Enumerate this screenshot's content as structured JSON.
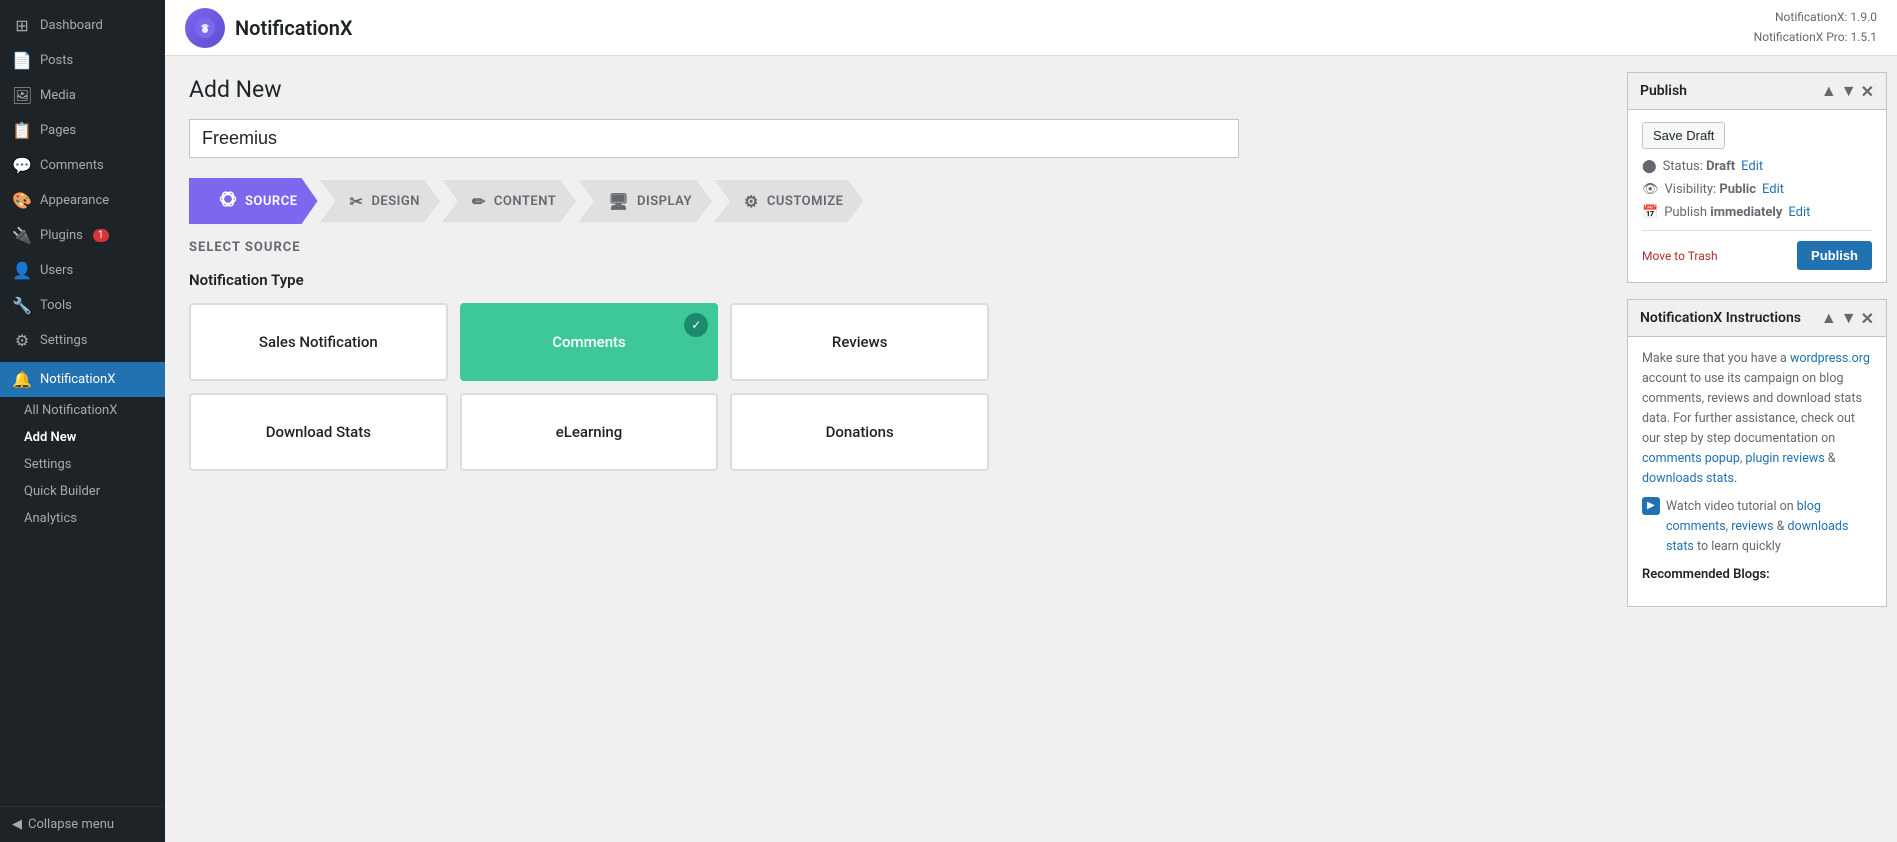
{
  "sidebar": {
    "items": [
      {
        "id": "dashboard",
        "label": "Dashboard",
        "icon": "⊞"
      },
      {
        "id": "posts",
        "label": "Posts",
        "icon": "📄"
      },
      {
        "id": "media",
        "label": "Media",
        "icon": "🖼"
      },
      {
        "id": "pages",
        "label": "Pages",
        "icon": "📋"
      },
      {
        "id": "comments",
        "label": "Comments",
        "icon": "💬"
      },
      {
        "id": "appearance",
        "label": "Appearance",
        "icon": "🎨"
      },
      {
        "id": "plugins",
        "label": "Plugins",
        "icon": "🔌",
        "badge": "1"
      },
      {
        "id": "users",
        "label": "Users",
        "icon": "👤"
      },
      {
        "id": "tools",
        "label": "Tools",
        "icon": "🔧"
      },
      {
        "id": "settings",
        "label": "Settings",
        "icon": "⚙"
      }
    ],
    "notificationx": {
      "label": "NotificationX",
      "subitems": [
        {
          "id": "all",
          "label": "All NotificationX"
        },
        {
          "id": "add-new",
          "label": "Add New",
          "active": true
        },
        {
          "id": "settings",
          "label": "Settings"
        },
        {
          "id": "quick-builder",
          "label": "Quick Builder"
        },
        {
          "id": "analytics",
          "label": "Analytics"
        }
      ]
    },
    "collapse_label": "Collapse menu"
  },
  "topbar": {
    "brand_name": "NotificationX",
    "version_line1": "NotificationX: 1.9.0",
    "version_line2": "NotificationX Pro: 1.5.1"
  },
  "page": {
    "title": "Add New",
    "title_input_value": "Freemius",
    "title_input_placeholder": "Freemius"
  },
  "steps": [
    {
      "id": "source",
      "label": "SOURCE",
      "icon": "⬡",
      "active": true
    },
    {
      "id": "design",
      "label": "DESIGN",
      "icon": "✂"
    },
    {
      "id": "content",
      "label": "CONTENT",
      "icon": "✏"
    },
    {
      "id": "display",
      "label": "DISPLAY",
      "icon": "🖥"
    },
    {
      "id": "customize",
      "label": "CUSTOMIZE",
      "icon": "⚙"
    }
  ],
  "select_source": {
    "section_label": "SELECT SOURCE",
    "notification_type_label": "Notification Type",
    "cards": [
      {
        "id": "sales-notification",
        "label": "Sales Notification",
        "selected": false
      },
      {
        "id": "comments",
        "label": "Comments",
        "selected": true
      },
      {
        "id": "reviews",
        "label": "Reviews",
        "selected": false
      },
      {
        "id": "download-stats",
        "label": "Download Stats",
        "selected": false
      },
      {
        "id": "elearning",
        "label": "eLearning",
        "selected": false
      },
      {
        "id": "donations",
        "label": "Donations",
        "selected": false
      }
    ]
  },
  "publish_widget": {
    "title": "Publish",
    "save_draft_label": "Save Draft",
    "status_label": "Status:",
    "status_value": "Draft",
    "status_edit": "Edit",
    "visibility_label": "Visibility:",
    "visibility_value": "Public",
    "visibility_edit": "Edit",
    "publish_label": "Publish",
    "publish_time": "immediately",
    "publish_edit": "Edit",
    "move_to_trash": "Move to Trash",
    "publish_btn": "Publish"
  },
  "instructions_widget": {
    "title": "NotificationX Instructions",
    "text1": "Make sure that you have a",
    "link_wordpress": "wordpress.org",
    "text2": "account to use its campaign on blog comments, reviews and download stats data. For further assistance, check out our step by step documentation on",
    "link_comments_popup": "comments popup",
    "link_plugin_reviews": "plugin reviews",
    "link_downloads_stats": "downloads stats",
    "text3": "Watch video tutorial on",
    "link_blog_comments": "blog comments",
    "link_reviews": "reviews",
    "link_downloads_stats2": "downloads stats",
    "text4": "to learn quickly",
    "recommended_label": "Recommended Blogs:"
  }
}
